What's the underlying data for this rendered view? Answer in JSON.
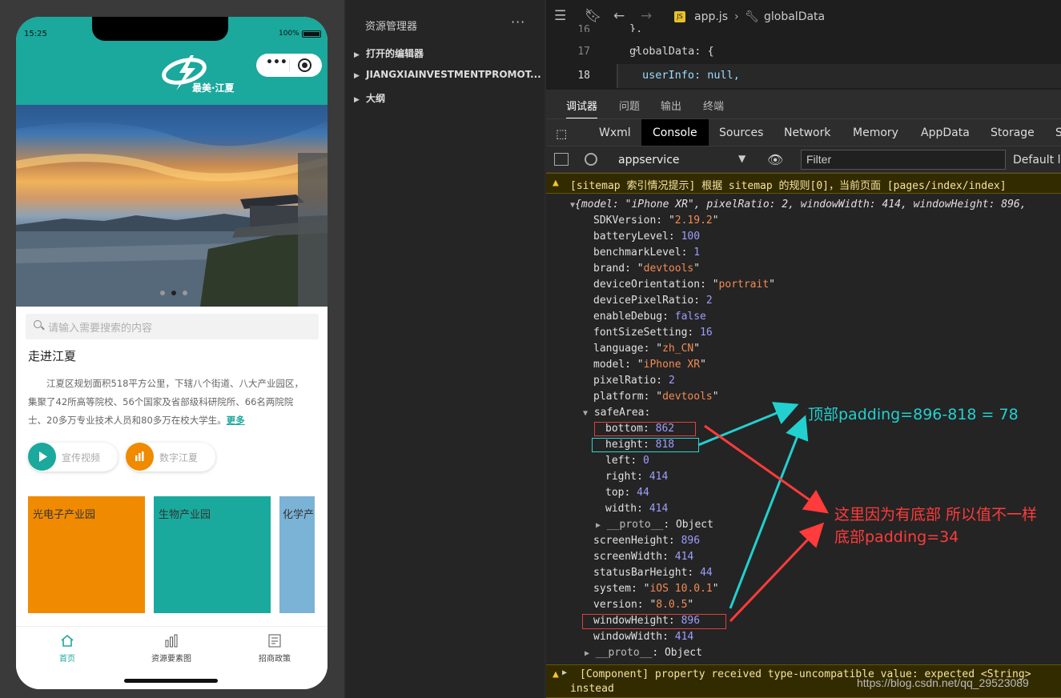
{
  "phone": {
    "time": "15:25",
    "battery": "100%",
    "logo_text": "最美·江夏",
    "search_placeholder": "请输入需要搜索的内容",
    "section_title": "走进江夏",
    "intro": "江夏区规划面积518平方公里，下辖八个街道、八大产业园区，集聚了42所高等院校、56个国家及省部级科研院所、66名两院院士、20多万专业技术人员和80多万在校大学生。",
    "more_link": "更多",
    "buttons": [
      {
        "label": "宣传视频"
      },
      {
        "label": "数字江夏"
      }
    ],
    "cards": [
      {
        "label": "光电子产业园",
        "color": "#f08a00"
      },
      {
        "label": "生物产业园",
        "color": "#1aaa9d"
      },
      {
        "label": "化学产",
        "color": "#7ab3d6"
      }
    ],
    "tabs": [
      {
        "label": "首页"
      },
      {
        "label": "资源要素图"
      },
      {
        "label": "招商政策"
      }
    ],
    "accent": "#1ba89d"
  },
  "explorer": {
    "title": "资源管理器",
    "more": "···",
    "items": [
      {
        "label": "打开的编辑器"
      },
      {
        "label": "JIANGXIAINVESTMENTPROMOT..."
      },
      {
        "label": "大纲"
      }
    ]
  },
  "editor": {
    "file": "app.js",
    "breadcrumb": "globalData",
    "lines": [
      {
        "num": "16",
        "code": "},"
      },
      {
        "num": "17",
        "code": "globalData: {"
      },
      {
        "num": "18",
        "code": "userInfo: null,"
      }
    ]
  },
  "devtools": {
    "top_tabs": [
      "调试器",
      "问题",
      "输出",
      "终端"
    ],
    "panel_tabs": [
      "Wxml",
      "Console",
      "Sources",
      "Network",
      "Memory",
      "AppData",
      "Storage",
      "S"
    ],
    "context": "appservice",
    "filter_placeholder": "Filter",
    "default_levels": "Default le",
    "warning1": "[sitemap 索引情况提示] 根据 sitemap 的规则[0]，当前页面 [pages/index/index]",
    "summary": "{model: \"iPhone XR\", pixelRatio: 2, windowWidth: 414, windowHeight: 896,",
    "props": [
      {
        "key": "SDKVersion",
        "value": "\"2.19.2\"",
        "type": "string"
      },
      {
        "key": "batteryLevel",
        "value": "100",
        "type": "number"
      },
      {
        "key": "benchmarkLevel",
        "value": "1",
        "type": "number"
      },
      {
        "key": "brand",
        "value": "\"devtools\"",
        "type": "string"
      },
      {
        "key": "deviceOrientation",
        "value": "\"portrait\"",
        "type": "string"
      },
      {
        "key": "devicePixelRatio",
        "value": "2",
        "type": "number"
      },
      {
        "key": "enableDebug",
        "value": "false",
        "type": "number"
      },
      {
        "key": "fontSizeSetting",
        "value": "16",
        "type": "number"
      },
      {
        "key": "language",
        "value": "\"zh_CN\"",
        "type": "string"
      },
      {
        "key": "model",
        "value": "\"iPhone XR\"",
        "type": "string"
      },
      {
        "key": "pixelRatio",
        "value": "2",
        "type": "number"
      },
      {
        "key": "platform",
        "value": "\"devtools\"",
        "type": "string"
      }
    ],
    "safearea_key": "safeArea",
    "safearea": [
      {
        "key": "bottom",
        "value": "862"
      },
      {
        "key": "height",
        "value": "818"
      },
      {
        "key": "left",
        "value": "0"
      },
      {
        "key": "right",
        "value": "414"
      },
      {
        "key": "top",
        "value": "44"
      },
      {
        "key": "width",
        "value": "414"
      }
    ],
    "proto": "__proto__",
    "proto_val": "Object",
    "props2": [
      {
        "key": "screenHeight",
        "value": "896",
        "type": "number"
      },
      {
        "key": "screenWidth",
        "value": "414",
        "type": "number"
      },
      {
        "key": "statusBarHeight",
        "value": "44",
        "type": "number"
      },
      {
        "key": "system",
        "value": "\"iOS 10.0.1\"",
        "type": "string"
      },
      {
        "key": "version",
        "value": "\"8.0.5\"",
        "type": "string"
      },
      {
        "key": "windowHeight",
        "value": "896",
        "type": "number"
      },
      {
        "key": "windowWidth",
        "value": "414",
        "type": "number"
      }
    ],
    "warning2": "[Component] property received type-uncompatible value: expected <String>",
    "warning2_cont": "instead",
    "watermark": "https://blog.csdn.net/qq_29523089"
  },
  "annotations": {
    "top_note": "顶部padding=896-818 = 78",
    "bottom_note1": "这里因为有底部 所以值不一样",
    "bottom_note2": "底部padding=34"
  }
}
